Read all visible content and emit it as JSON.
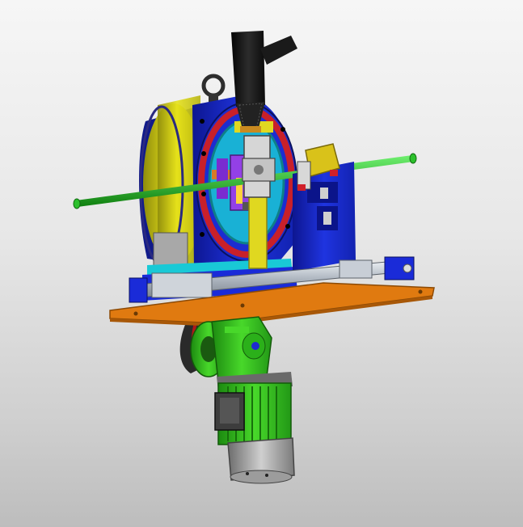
{
  "viewport": {
    "background_top": "#f6f6f6",
    "background_bottom": "#bdbdbd"
  },
  "model": {
    "colors": {
      "base_plate": "#e07a10",
      "frame_blue": "#1a2bd8",
      "housing_yellow": "#e6e21a",
      "motor_green": "#33c21a",
      "torch_black": "#161616",
      "rail_gray": "#b8bfc8",
      "rod_green": "#1fb31f",
      "belt_dark": "#2a2a2a",
      "ring_red": "#c8202a",
      "cyan_detail": "#19c9d6",
      "purple_detail": "#7a2bd0",
      "yellow_clamp": "#d9c21a"
    }
  }
}
